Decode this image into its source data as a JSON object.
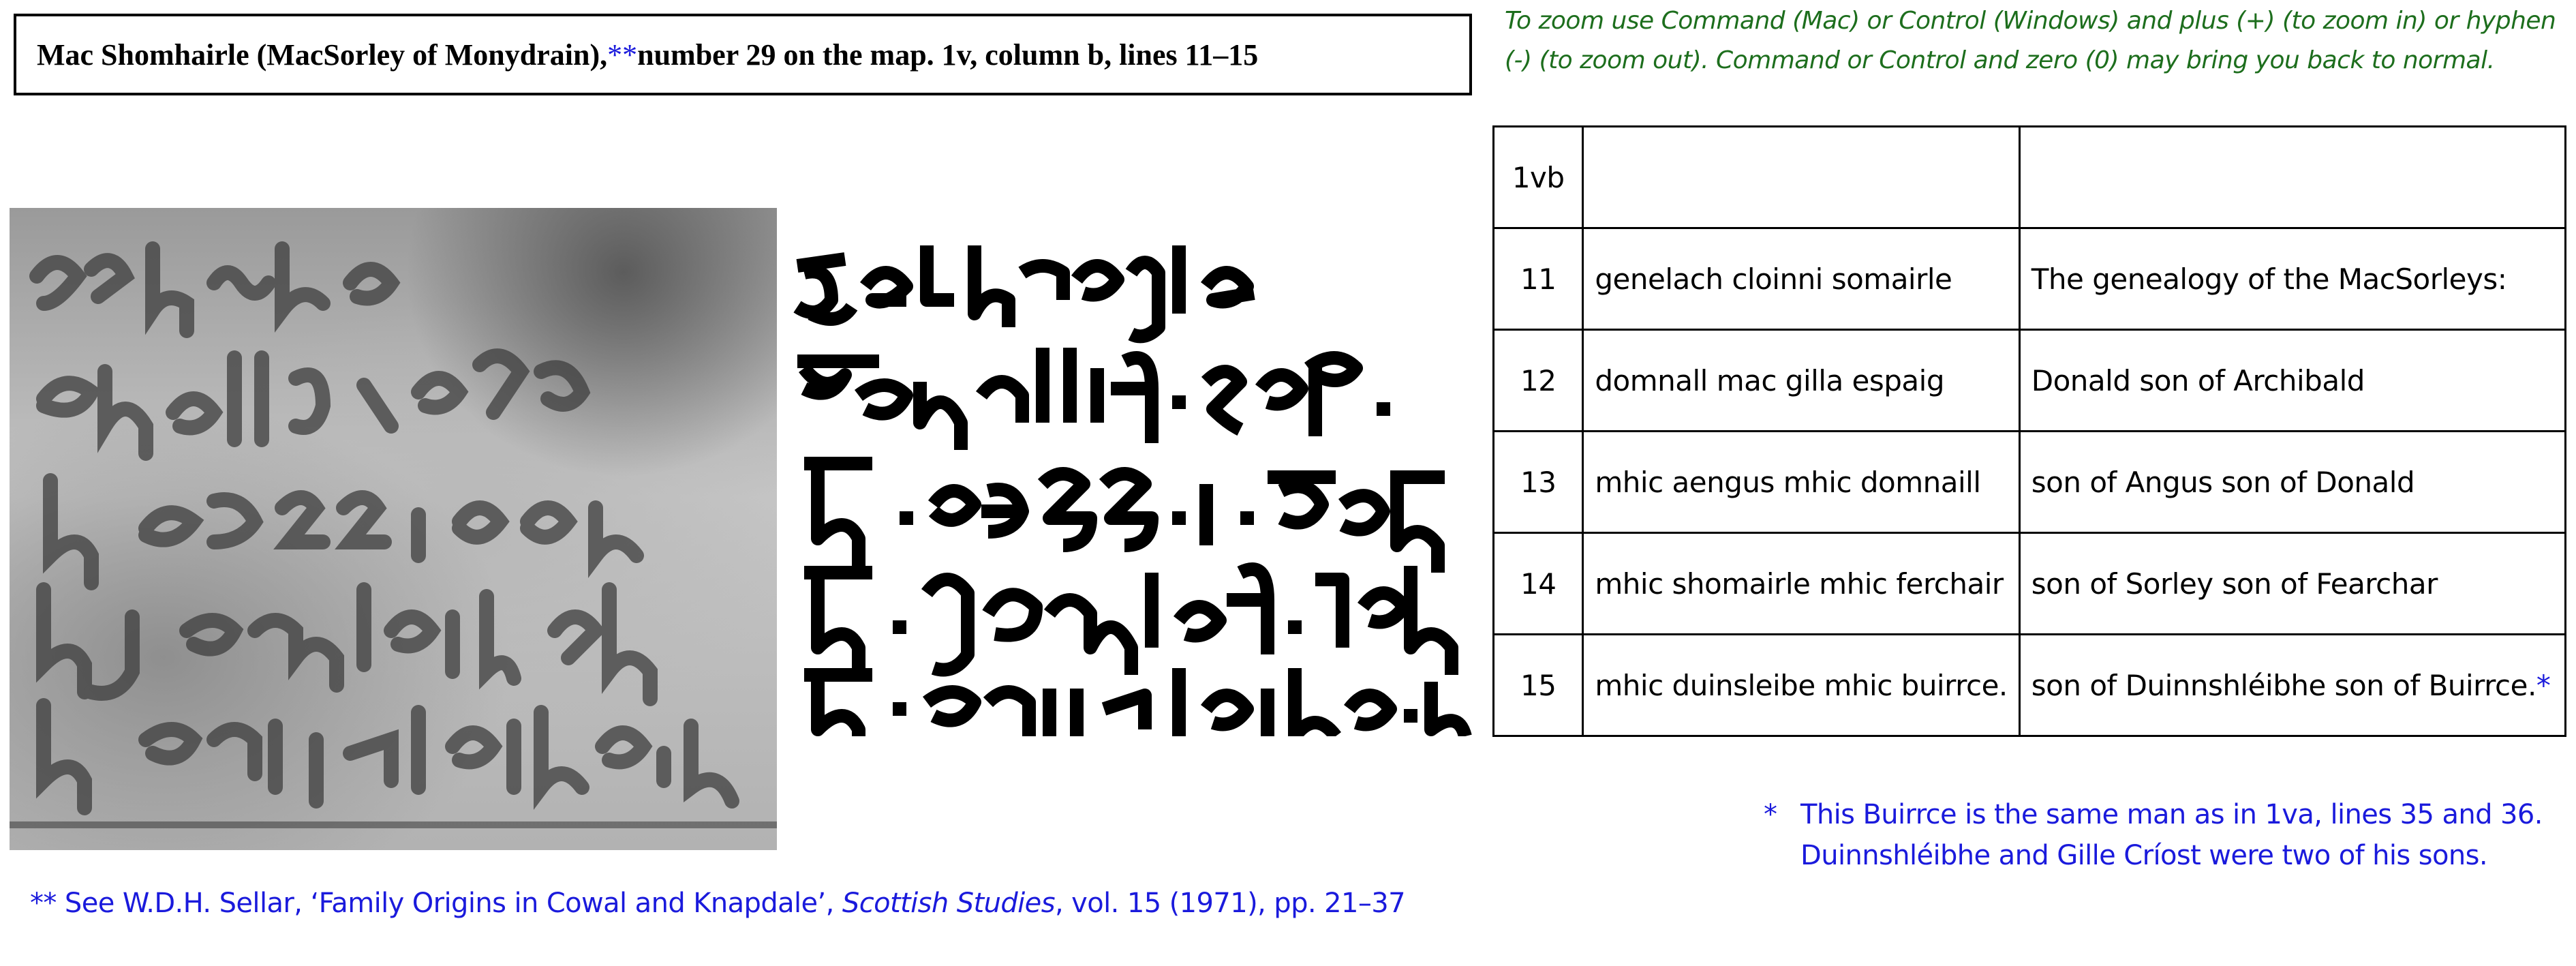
{
  "title": {
    "main": "Mac Shomhairle (MacSorley of Monydrain),",
    "stars": "**",
    "rest": " number 29 on the map. 1v, column b, lines 11–15"
  },
  "zoom_note": "To zoom use Command (Mac) or Control (Windows) and plus (+) (to zoom in) or hyphen (-) (to zoom out).  Command or Control and zero (0) may bring you back to normal.",
  "table": {
    "header": {
      "num": "1vb",
      "irish": "",
      "english": ""
    },
    "rows": [
      {
        "num": "11",
        "irish": "genelach cloinni somairle",
        "english": "The genealogy of the MacSorleys:"
      },
      {
        "num": "12",
        "irish": "domnall mac gilla espaig",
        "english": "Donald son of Archibald"
      },
      {
        "num": "13",
        "irish": "mhic aengus mhic domnaill",
        "english": "son of Angus son of Donald"
      },
      {
        "num": "14",
        "irish": "mhic shomairle mhic ferchair",
        "english": "son of Sorley son of Fearchar"
      },
      {
        "num": "15",
        "irish": "mhic duinsleibe mhic buirrce.",
        "english": "son of Duinnshléibhe son of Buirrce.",
        "mark": "*"
      }
    ]
  },
  "footnotes": {
    "right_mark": "*",
    "right_line1": "This Buirrce is the same man as in 1va, lines 35 and 36.",
    "right_line2": "Duinnshléibhe and Gille Críost were two of his sons.",
    "left_prefix": "** See W.D.H. Sellar, ‘Family Origins in Cowal and Knapdale’, ",
    "left_journal": "Scottish Studies",
    "left_suffix": ", vol. 15 (1971), pp. 21–37"
  },
  "colors": {
    "note_green": "#1d6e1d",
    "link_blue": "#1a1adc",
    "ink": "#000000"
  }
}
